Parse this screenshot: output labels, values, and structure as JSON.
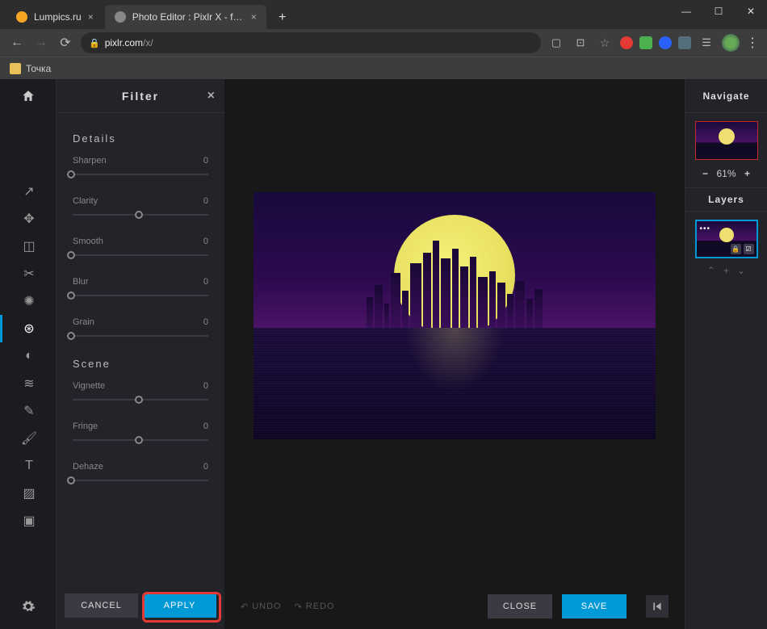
{
  "browser": {
    "tabs": [
      {
        "title": "Lumpics.ru",
        "favicon_color": "#f5a623",
        "active": false
      },
      {
        "title": "Photo Editor : Pixlr X - free image",
        "favicon_color": "#888",
        "active": true
      }
    ],
    "url_domain": "pixlr.com",
    "url_path": "/x/",
    "bookmark": "Точка"
  },
  "panel": {
    "title": "Filter",
    "sections": {
      "details": {
        "title": "Details",
        "sliders": [
          {
            "label": "Sharpen",
            "value": "0",
            "thumb_pct": 0
          },
          {
            "label": "Clarity",
            "value": "0",
            "thumb_pct": 50
          },
          {
            "label": "Smooth",
            "value": "0",
            "thumb_pct": 0
          },
          {
            "label": "Blur",
            "value": "0",
            "thumb_pct": 0
          },
          {
            "label": "Grain",
            "value": "0",
            "thumb_pct": 0
          }
        ]
      },
      "scene": {
        "title": "Scene",
        "sliders": [
          {
            "label": "Vignette",
            "value": "0",
            "thumb_pct": 50
          },
          {
            "label": "Fringe",
            "value": "0",
            "thumb_pct": 50
          },
          {
            "label": "Dehaze",
            "value": "0",
            "thumb_pct": 0
          }
        ]
      }
    },
    "buttons": {
      "cancel": "CANCEL",
      "apply": "APPLY"
    }
  },
  "tools": [
    {
      "name": "arrange-tool",
      "glyph": "↗"
    },
    {
      "name": "move-tool",
      "glyph": "✥"
    },
    {
      "name": "crop-tool",
      "glyph": "◫"
    },
    {
      "name": "cut-tool",
      "glyph": "✂"
    },
    {
      "name": "adjust-tool",
      "glyph": "✺"
    },
    {
      "name": "filter-tool",
      "glyph": "⊛",
      "active": true
    },
    {
      "name": "liquify-tool",
      "glyph": "◐"
    },
    {
      "name": "retouch-tool",
      "glyph": "≋"
    },
    {
      "name": "draw-tool",
      "glyph": "✎"
    },
    {
      "name": "brush-tool",
      "glyph": "🖌"
    },
    {
      "name": "text-tool",
      "glyph": "T"
    },
    {
      "name": "element-tool",
      "glyph": "▨"
    },
    {
      "name": "image-tool",
      "glyph": "▣"
    }
  ],
  "bottom": {
    "undo": "UNDO",
    "redo": "REDO",
    "close": "CLOSE",
    "save": "SAVE"
  },
  "navigate": {
    "title": "Navigate",
    "zoom": "61%"
  },
  "layers": {
    "title": "Layers"
  }
}
